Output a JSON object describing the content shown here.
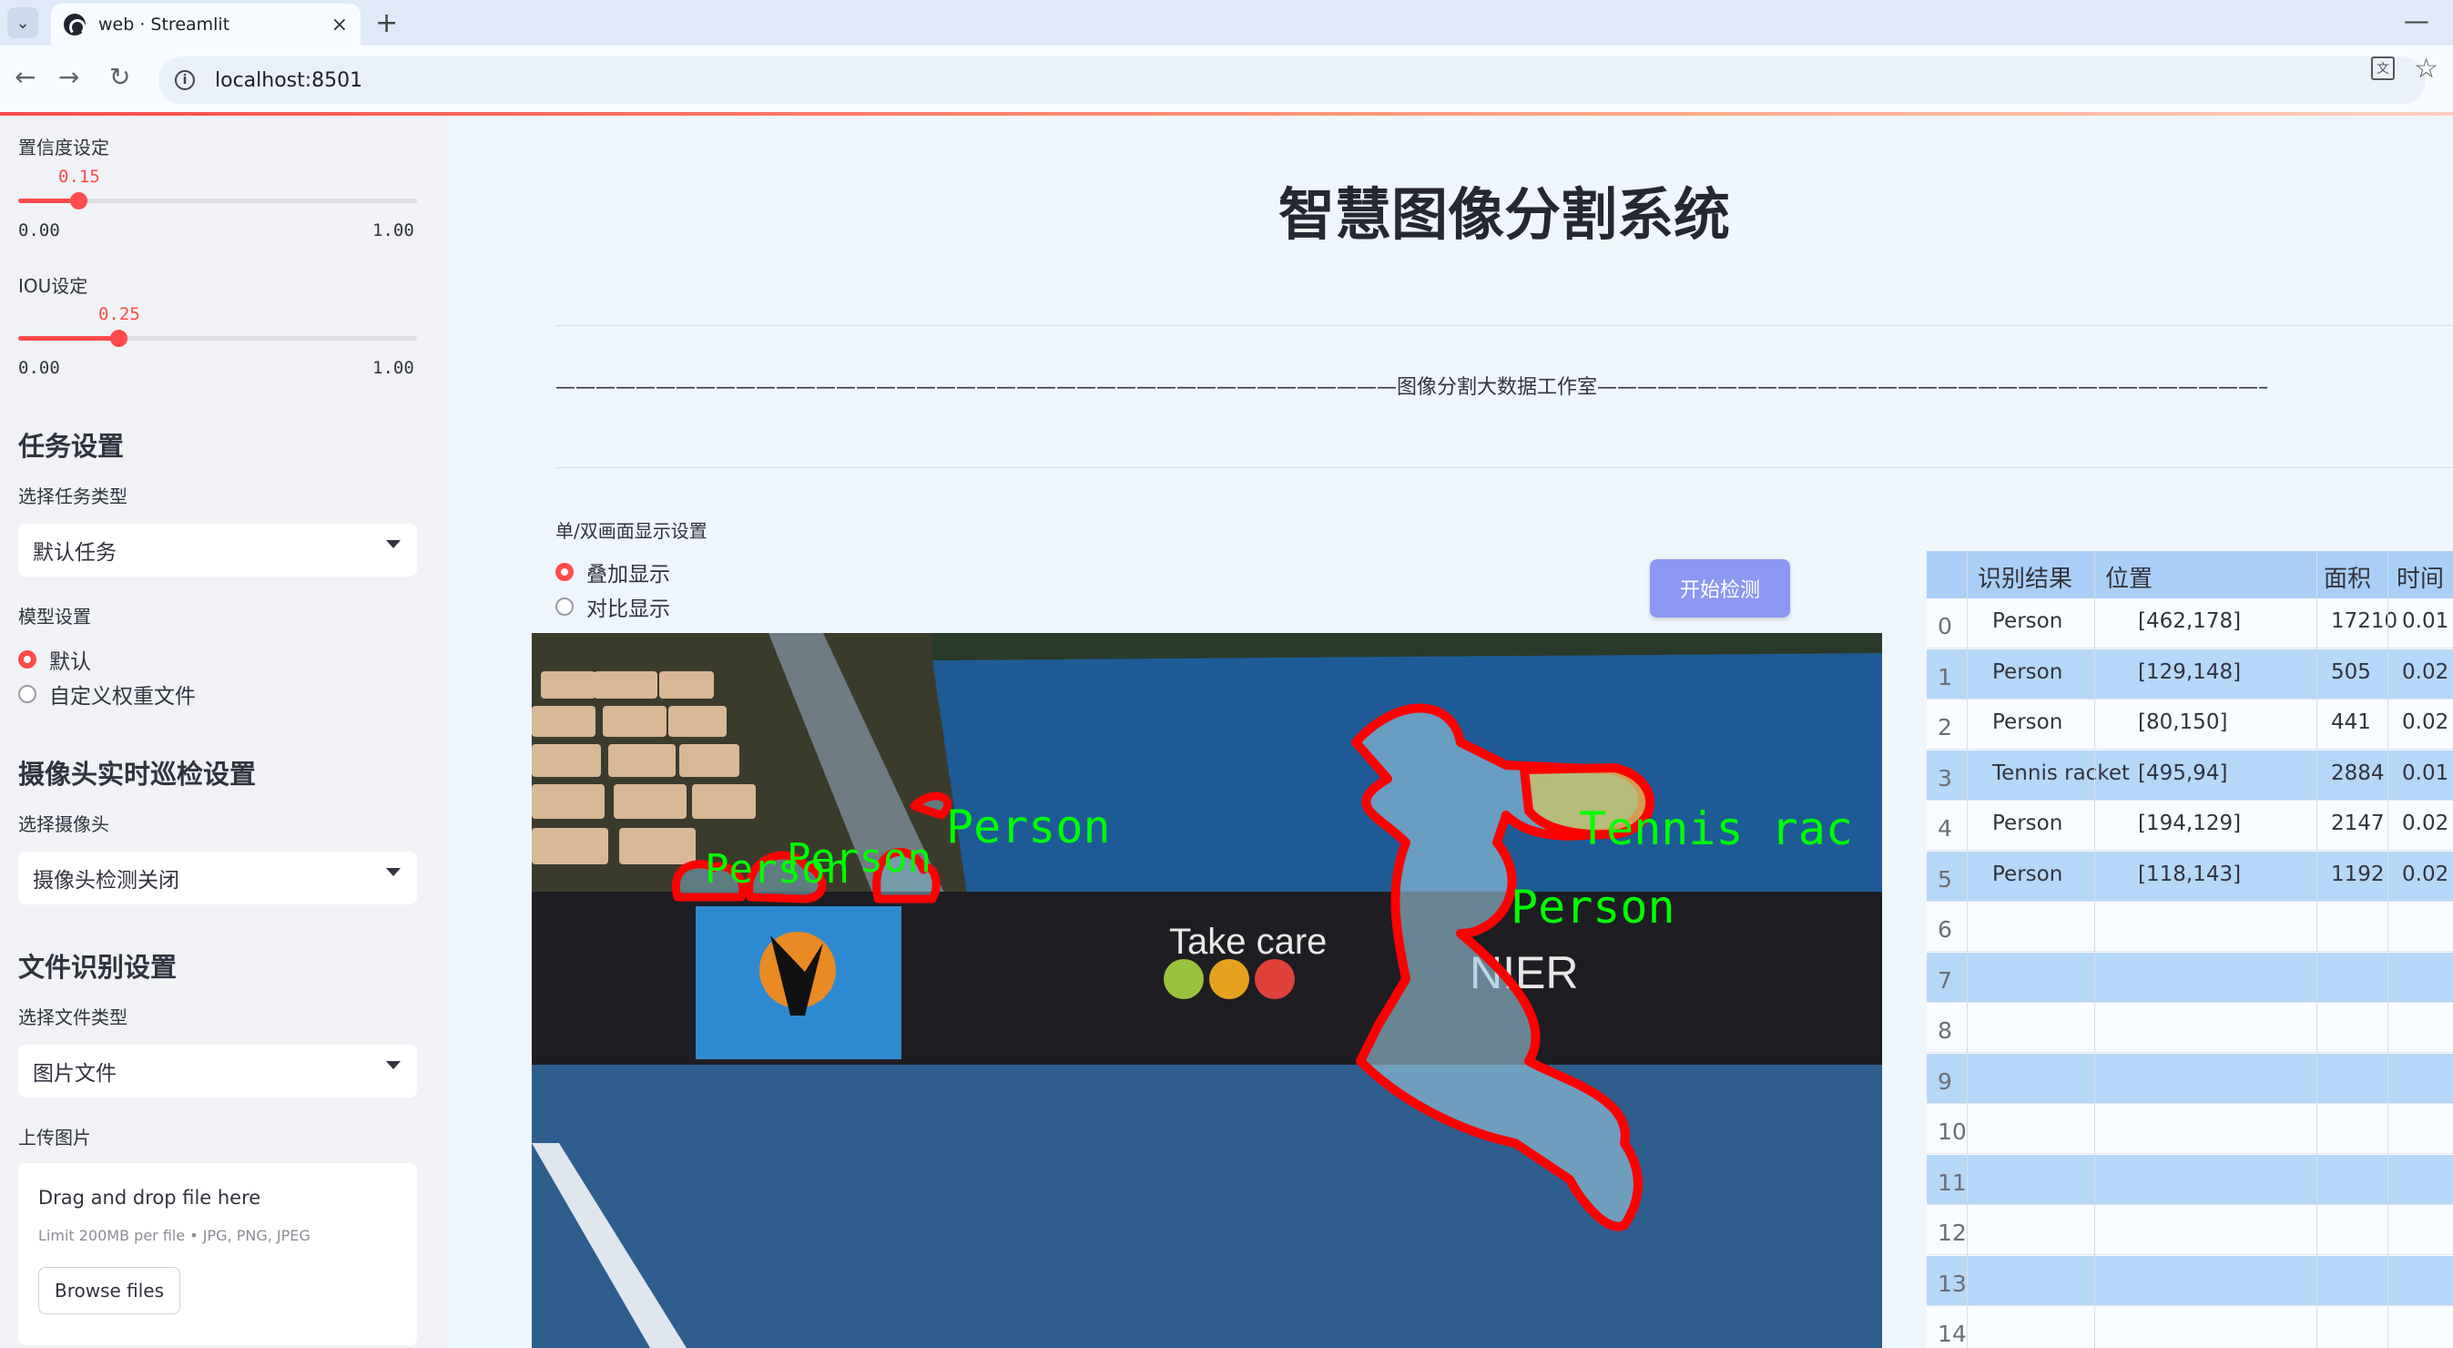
{
  "browser": {
    "tab_title": "web · Streamlit",
    "url": "localhost:8501"
  },
  "sidebar": {
    "confidence": {
      "label": "置信度设定",
      "value": 0.15,
      "value_text": "0.15",
      "min": "0.00",
      "max": "1.00"
    },
    "iou": {
      "label": "IOU设定",
      "value": 0.25,
      "value_text": "0.25",
      "min": "0.00",
      "max": "1.00"
    },
    "task_header": "任务设置",
    "task_type_label": "选择任务类型",
    "task_type_value": "默认任务",
    "model_label": "模型设置",
    "model_options": [
      "默认",
      "自定义权重文件"
    ],
    "camera_header": "摄像头实时巡检设置",
    "camera_label": "选择摄像头",
    "camera_value": "摄像头检测关闭",
    "file_header": "文件识别设置",
    "file_type_label": "选择文件类型",
    "file_type_value": "图片文件",
    "upload_label": "上传图片",
    "upload_title": "Drag and drop file here",
    "upload_limit": "Limit 200MB per file • JPG, PNG, JPEG",
    "browse_label": "Browse files"
  },
  "main": {
    "title": "智慧图像分割系统",
    "studio_line": "——————————————————————————————————————————图像分割大数据工作室——————————————————————————————————————————",
    "display_label": "单/双画面显示设置",
    "display_options": [
      "叠加显示",
      "对比显示"
    ],
    "start_button": "开始检测"
  },
  "detections": {
    "labels": [
      "Person",
      "Person",
      "Person",
      "Person",
      "Tennis rac"
    ],
    "banner_text_1": "Take care",
    "banner_text_2": "NIER"
  },
  "results_table": {
    "headers": [
      "识别结果",
      "位置",
      "面积",
      "时间"
    ],
    "rows": [
      {
        "index": "0",
        "label": "Person",
        "position": "[462,178]",
        "area": "17210",
        "time": "0.01"
      },
      {
        "index": "1",
        "label": "Person",
        "position": "[129,148]",
        "area": "505",
        "time": "0.02"
      },
      {
        "index": "2",
        "label": "Person",
        "position": "[80,150]",
        "area": "441",
        "time": "0.02"
      },
      {
        "index": "3",
        "label": "Tennis racket",
        "position": "[495,94]",
        "area": "2884",
        "time": "0.01"
      },
      {
        "index": "4",
        "label": "Person",
        "position": "[194,129]",
        "area": "2147",
        "time": "0.02"
      },
      {
        "index": "5",
        "label": "Person",
        "position": "[118,143]",
        "area": "1192",
        "time": "0.02"
      },
      {
        "index": "6"
      },
      {
        "index": "7"
      },
      {
        "index": "8"
      },
      {
        "index": "9"
      },
      {
        "index": "10"
      },
      {
        "index": "11"
      },
      {
        "index": "12"
      },
      {
        "index": "13"
      },
      {
        "index": "14"
      }
    ]
  },
  "colors": {
    "accent": "#ff4b4b",
    "button": "#8b97f1",
    "table_header": "#a9cff6",
    "mask_outline": "#ff0000",
    "label_text": "#00ff00"
  }
}
